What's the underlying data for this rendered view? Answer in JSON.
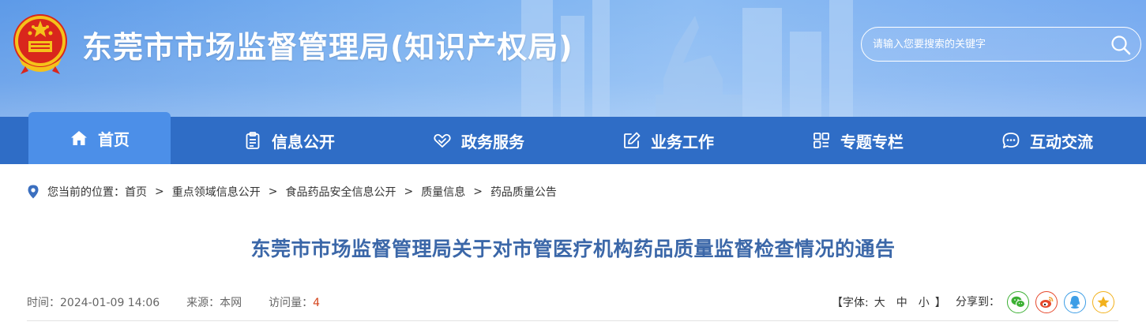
{
  "header": {
    "site_title": "东莞市市场监督管理局(知识产权局)",
    "search_placeholder": "请输入您要搜索的关键字"
  },
  "nav": {
    "items": [
      {
        "label": "首页",
        "icon": "home-icon"
      },
      {
        "label": "信息公开",
        "icon": "clipboard-icon"
      },
      {
        "label": "政务服务",
        "icon": "heart-hands-icon"
      },
      {
        "label": "业务工作",
        "icon": "edit-icon"
      },
      {
        "label": "专题专栏",
        "icon": "grid-icon"
      },
      {
        "label": "互动交流",
        "icon": "chat-icon"
      }
    ]
  },
  "breadcrumb": {
    "prefix": "您当前的位置：",
    "items": [
      "首页",
      "重点领域信息公开",
      "食品药品安全信息公开",
      "质量信息",
      "药品质量公告"
    ],
    "separator": ">"
  },
  "article": {
    "title": "东莞市市场监督管理局关于对市管医疗机构药品质量监督检查情况的通告",
    "time": "时间：2024-01-09 14:06",
    "source": "来源：本网",
    "visits_label": "访问量：",
    "visits_value": "4"
  },
  "font_control": {
    "open": "【字体:",
    "large": "大",
    "medium": "中",
    "small": "小",
    "close": "】"
  },
  "share": {
    "label": "分享到：",
    "targets": [
      {
        "icon": "wechat-icon",
        "color": "#3cb034"
      },
      {
        "icon": "weibo-icon",
        "color": "#e6492d"
      },
      {
        "icon": "qq-icon",
        "color": "#3d9ee6"
      },
      {
        "icon": "qzone-icon",
        "color": "#f2b11d"
      }
    ]
  },
  "colors": {
    "nav_bg": "#2f6dc6",
    "nav_active": "#4c8fe8",
    "title_color": "#3b67a8",
    "visits_color": "#d4431b"
  }
}
